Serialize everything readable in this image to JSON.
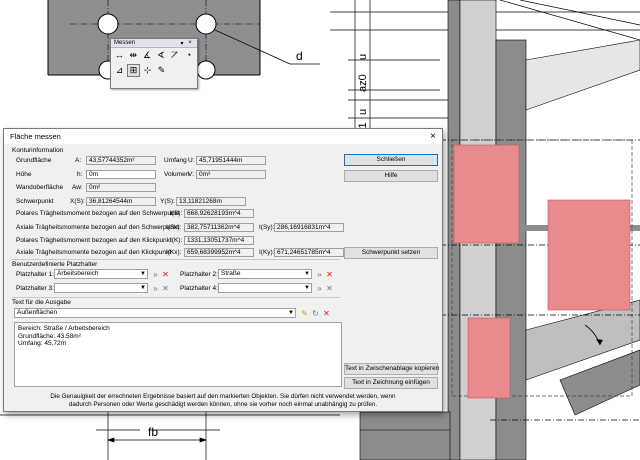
{
  "drawing": {
    "label_d": "d",
    "label_u": "u",
    "label_az0": "az0",
    "label_u_lower": "u",
    "label_z1": "z1",
    "label_fb": "fb"
  },
  "toolbar": {
    "title": "Messen",
    "pin": "▾",
    "close": "×"
  },
  "dialog": {
    "title": "Fläche messen",
    "close": "×",
    "kontur_header": "Konturinformation",
    "grundflaeche_label": "Grundfläche",
    "a_label": "A:",
    "a_value": "43,57744352m²",
    "umfang_label": "Umfang",
    "u_label": "U:",
    "u_value": "45,71951444m",
    "hoehe_label": "Höhe",
    "h_label": "h:",
    "h_value": "0m",
    "volumen_label": "Volumen",
    "v_label": "V:",
    "v_value": "0m³",
    "wand_label": "Wandoberfläche",
    "aw_label": "Aw:",
    "aw_value": "0m²",
    "schwerpunkt_label": "Schwerpunkt",
    "xs_label": "X(S):",
    "xs_value": "36,81264544m",
    "ys_label": "Y(S):",
    "ys_value": "13,11821268m",
    "polar_s_label": "Polares Trägheitsmoment bezogen auf den Schwerpunkt",
    "is_label": "I(S):",
    "is_value": "668,92628193m^4",
    "axial_s_label": "Axiale Trägheitsmomente bezogen auf den Schwerpunkt",
    "isx_label": "I(Sx):",
    "isx_value": "382,75711362m^4",
    "isy_label": "I(Sy):",
    "isy_value": "286,16916831m^4",
    "polar_k_label": "Polares Trägheitsmoment bezogen auf den Klickpunkt",
    "ik_label": "I(K):",
    "ik_value": "1331,13051737m^4",
    "axial_k_label": "Axiale Trägheitsmomente bezogen auf den Klickpunkt",
    "ikx_label": "I(Kx):",
    "ikx_value": "659,68399952m^4",
    "iky_label": "I(Ky):",
    "iky_value": "671,24651785m^4",
    "platzhalter_header": "Benutzerdefinierte Platzhalter",
    "ph1_label": "Platzhalter 1:",
    "ph1_value": "Arbeitsbereich",
    "ph2_label": "Platzhalter 2:",
    "ph2_value": "Straße",
    "ph3_label": "Platzhalter 3:",
    "ph3_value": "",
    "ph4_label": "Platzhalter 4:",
    "ph4_value": "",
    "ausgabe_header": "Text für die Ausgabe",
    "ausgabe_select": "Außenflächen",
    "ausgabe_line1": "Bereich: Straße / Arbeitsbereich",
    "ausgabe_line2": "Grundfläche: 43.58m²",
    "ausgabe_line3": "Umfang: 45,72m",
    "btn_schliessen": "Schließen",
    "btn_hilfe": "Hilfe",
    "btn_schwerpunkt": "Schwerpunkt setzen",
    "btn_clipboard": "Text in Zwischenablage kopieren",
    "btn_zeichnung": "Text in Zeichnung einfügen",
    "footer_line1": "Die Genauigkeit der errechneten Ergebnisse basiert auf den markierten Objekten. Sie dürfen nicht verwendet werden, wenn",
    "footer_line2": "dadurch Personen oder Werte geschädigt werden können, ohne sie vorher noch einmal unabhängig zu prüfen."
  },
  "colors": {
    "highlight_fill": "#e98a8e",
    "steel_grey": "#8c8c8c",
    "dialog_bg": "#f0f0f0"
  }
}
